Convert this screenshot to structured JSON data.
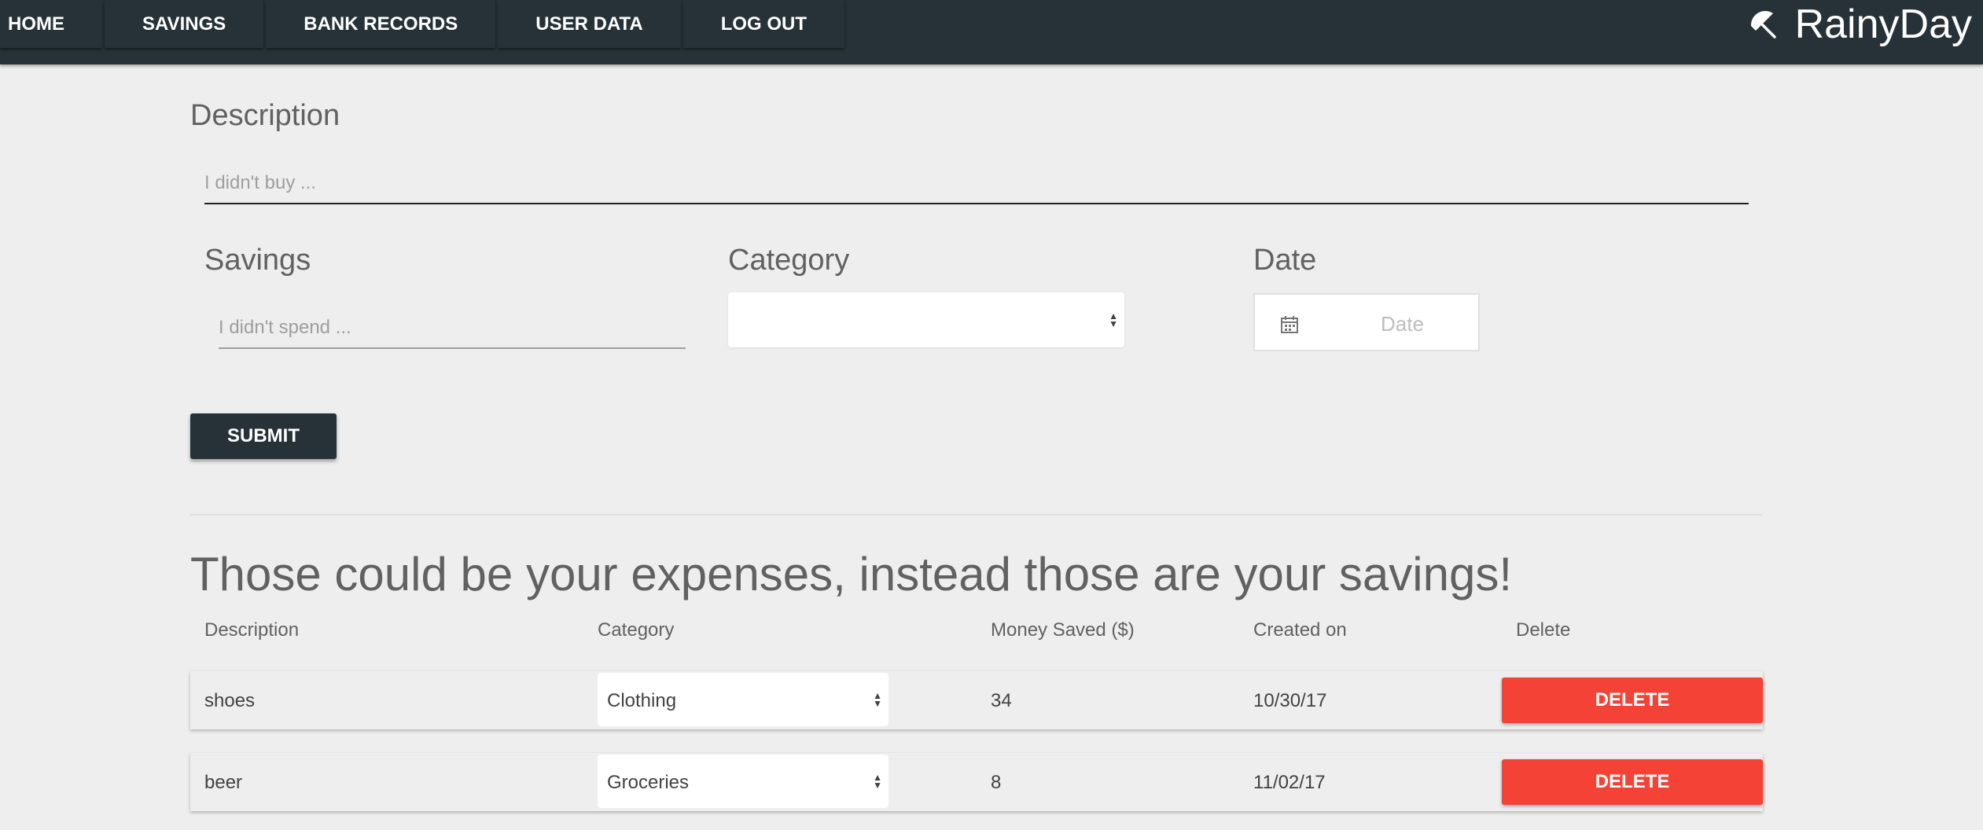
{
  "nav": {
    "items": [
      "HOME",
      "SAVINGS",
      "BANK RECORDS",
      "USER DATA",
      "LOG OUT"
    ],
    "brand": "RainyDay",
    "brand_icon": "umbrella-icon",
    "background": "#263238"
  },
  "form": {
    "description_label": "Description",
    "description_placeholder": "I didn't buy ...",
    "savings_label": "Savings",
    "savings_placeholder": "I didn't spend ...",
    "category_label": "Category",
    "category_value": "",
    "date_label": "Date",
    "date_placeholder": "Date",
    "submit_label": "SUBMIT"
  },
  "table": {
    "title": "Those could be your expenses, instead those are your savings!",
    "headers": [
      "Description",
      "Category",
      "Money Saved ($)",
      "Created on",
      "Delete"
    ],
    "rows": [
      {
        "description": "shoes",
        "category": "Clothing",
        "money": "34",
        "created": "10/30/17",
        "action": "DELETE"
      },
      {
        "description": "beer",
        "category": "Groceries",
        "money": "8",
        "created": "11/02/17",
        "action": "DELETE"
      }
    ]
  },
  "colors": {
    "accent_dark": "#263238",
    "delete_red": "#f44336",
    "background": "#eeeeee"
  }
}
